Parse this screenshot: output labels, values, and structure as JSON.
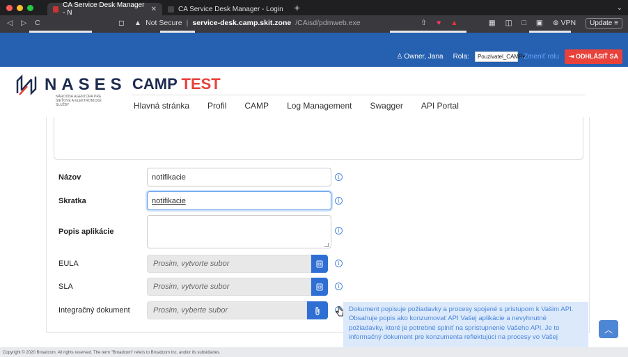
{
  "browser": {
    "tabs": [
      {
        "label": "CA Service Desk Manager - N",
        "active": true
      },
      {
        "label": "CA Service Desk Manager - Login",
        "active": false
      }
    ],
    "security": "Not Secure",
    "url_host": "service-desk.camp.skit.zone",
    "url_path": "/CAisd/pdmweb.exe",
    "vpn": "VPN",
    "update": "Update"
  },
  "topbar": {
    "user": "Owner, Jana",
    "rola_label": "Rola:",
    "rola_value": "Pouzivatel_CAMP",
    "zmenit": "Zmeniť rolu",
    "logout": "ODHLÁSIŤ SA"
  },
  "header": {
    "logo_word": "NASES",
    "logo_sub": "NÁRODNÁ AGENTÚRA PRE SIEŤOVÉ A ELEKTRONICKÉ SLUŽBY",
    "app_name_1": "CAMP",
    "app_name_2": "TEST"
  },
  "menu": [
    "Hlavná stránka",
    "Profil",
    "CAMP",
    "Log Management",
    "Swagger",
    "API Portal"
  ],
  "form": {
    "nazov_label": "Názov",
    "nazov_value": "notifikacie",
    "skratka_label": "Skratka",
    "skratka_value": "notifikacie",
    "popis_label": "Popis aplikácie",
    "eula_label": "EULA",
    "eula_placeholder": "Prosim, vytvorte subor",
    "sla_label": "SLA",
    "sla_placeholder": "Prosim, vytvorte subor",
    "integ_label": "Integračný dokument",
    "integ_placeholder": "Prosim, vyberte subor"
  },
  "tooltip": "Dokument popisuje požiadavky a procesy spojené s prístupom k Vašim API. Obsahuje popis ako konzumovať API Vašej aplikácie a nevyhnutné požiadavky, ktoré je potrebné splniť na sprístupnenie Vašeho API. Je to informačný dokument pre konzumenta reflektujúci na procesy vo Vašej",
  "footer": "Copyright © 2020 Broadcom. All rights reserved. The term \"Broadcom\" refers to Broadcom Inc. and/or its subsidiaries.",
  "colors": {
    "brand_blue": "#2660b0",
    "logout_red": "#e8423b",
    "button_blue": "#2f6fd4"
  }
}
